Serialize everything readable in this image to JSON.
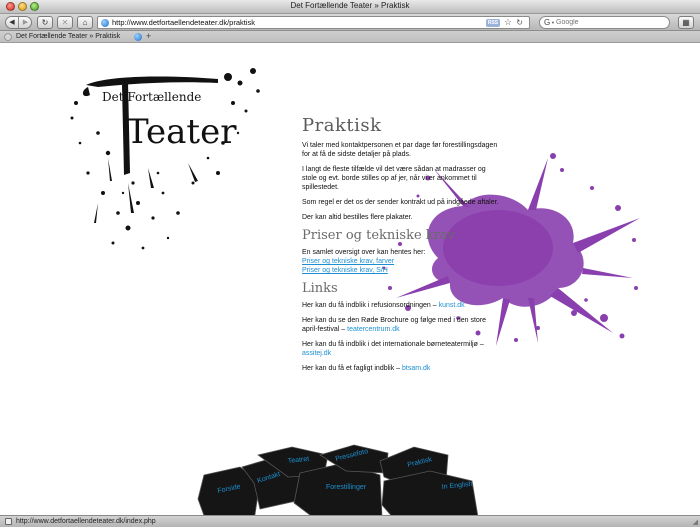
{
  "window": {
    "title": "Det Fortællende Teater » Praktisk"
  },
  "toolbar": {
    "url": "http://www.detfortaellendeteater.dk/praktisk",
    "rss_label": "RSS",
    "search_placeholder": "Google"
  },
  "tabs": [
    {
      "label": "Det Fortællende Teater » Praktisk"
    }
  ],
  "logo": {
    "text_small": "Det Fortællende",
    "text_big": "Teater"
  },
  "praktisk": {
    "heading": "Praktisk",
    "paragraphs": [
      "Vi taler med kontaktpersonen et par dage før forestillingsdagen for at få de sidste detaljer på plads.",
      "I langt de fleste tilfælde vil det være sådan at madrasser og stole og evt. borde stilles op af jer, når vi er ankommet til spillestedet.",
      "Som regel er det os der sender kontrakt ud på indgåede aftaler.",
      "Der kan altid bestilles flere plakater."
    ]
  },
  "priser": {
    "heading": "Priser og tekniske krav",
    "intro": "En samlet oversigt over kan hentes her:",
    "links": [
      "Priser og tekniske krav, farver",
      "Priser og tekniske krav, S/H"
    ]
  },
  "links_section": {
    "heading": "Links",
    "items": [
      {
        "text": "Her kan du få indblik i refusionsordningen –",
        "link": "kunst.dk"
      },
      {
        "text": "Her kan du se den Røde Brochure og følge med i den store april-festival –",
        "link": "teatercentrum.dk"
      },
      {
        "text": "Her kan du få indblik i det internationale børneteatermiljø –",
        "link": "assitej.dk"
      },
      {
        "text": "Her kan du få et fagligt indblik –",
        "link": "btsam.dk"
      }
    ]
  },
  "nav_rocks": {
    "items": [
      "Forside",
      "Kontakt",
      "Teatret",
      "Forestillinger",
      "Pressefoto",
      "Praktisk",
      "In English"
    ]
  },
  "statusbar": {
    "text": "http://www.detfortaellendeteater.dk/index.php"
  },
  "colors": {
    "link": "#1d8fd0",
    "splash": "#8a3fae",
    "ink": "#111111",
    "heading": "#5a5a5a"
  }
}
